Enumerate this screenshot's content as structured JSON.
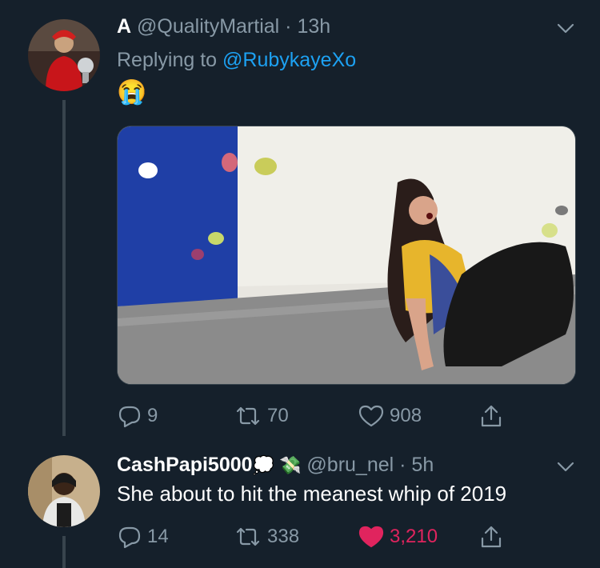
{
  "tweet1": {
    "name": "A",
    "handle": "@QualityMartial",
    "separator": "·",
    "time": "13h",
    "replying_prefix": "Replying to",
    "replying_to": "@RubykayeXo",
    "emoji": "😭",
    "actions": {
      "replies": "9",
      "retweets": "70",
      "likes": "908"
    }
  },
  "tweet2": {
    "name": "CashPapi5000",
    "name_emojis": "💭 💸",
    "handle": "@bru_nel",
    "separator": "·",
    "time": "5h",
    "text": "She about to hit the meanest whip of 2019",
    "actions": {
      "replies": "14",
      "retweets": "338",
      "likes": "3,210"
    }
  },
  "colors": {
    "background": "#15202b",
    "secondary_text": "#8899a6",
    "link": "#1da1f2",
    "like_active": "#e0245e",
    "thread_line": "#38444d"
  },
  "icons": [
    "chevron-down-icon",
    "reply-icon",
    "retweet-icon",
    "heart-icon",
    "share-icon"
  ]
}
